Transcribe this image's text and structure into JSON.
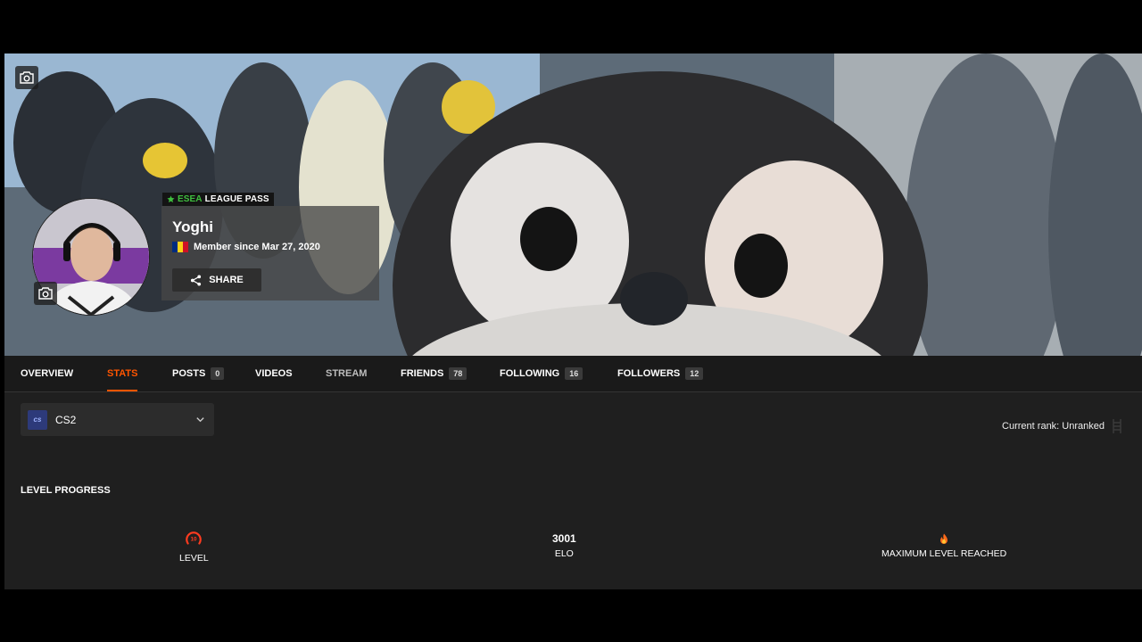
{
  "profile": {
    "username": "Yoghi",
    "league_badge": {
      "brand": "ESEA",
      "label": "LEAGUE PASS"
    },
    "member_since": "Member since Mar 27, 2020",
    "share_label": "SHARE",
    "flag_colors": [
      "#002b7f",
      "#fcd116",
      "#ce1126"
    ]
  },
  "tabs": [
    {
      "label": "OVERVIEW",
      "count": null
    },
    {
      "label": "STATS",
      "count": null,
      "active": true
    },
    {
      "label": "POSTS",
      "count": "0"
    },
    {
      "label": "VIDEOS",
      "count": null
    },
    {
      "label": "STREAM",
      "count": null
    },
    {
      "label": "FRIENDS",
      "count": "78"
    },
    {
      "label": "FOLLOWING",
      "count": "16"
    },
    {
      "label": "FOLLOWERS",
      "count": "12"
    }
  ],
  "game_select": {
    "logo_text": "cs",
    "value": "CS2"
  },
  "rank": {
    "text": "Current rank: Unranked"
  },
  "level_progress": {
    "title": "LEVEL PROGRESS",
    "level": {
      "value": "10",
      "label": "LEVEL"
    },
    "elo": {
      "value": "3001",
      "label": "ELO"
    },
    "max": {
      "label": "MAXIMUM LEVEL REACHED"
    }
  },
  "colors": {
    "accent": "#ff5500",
    "background": "#1f1f1f",
    "esea_green": "#3fbf3f"
  },
  "icons": [
    "camera-icon",
    "share-icon",
    "chevron-down-icon",
    "level-10-icon",
    "flame-icon",
    "ladder-icon"
  ]
}
